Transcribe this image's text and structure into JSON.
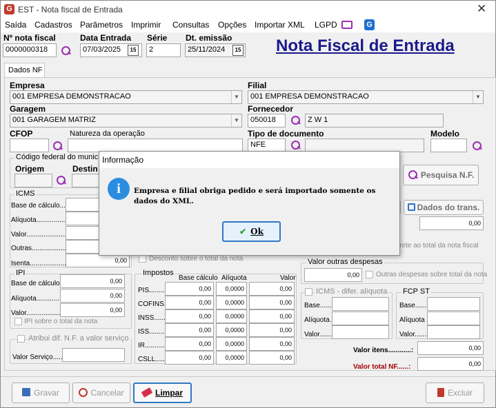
{
  "window": {
    "title": "EST - Nota fiscal de Entrada"
  },
  "menu": [
    "Saída",
    "Cadastros",
    "Parâmetros",
    "Imprimir",
    "Consultas",
    "Opções",
    "Importar XML",
    "LGPD"
  ],
  "header": {
    "nota_label": "Nº nota fiscal",
    "nota_value": "0000000318",
    "data_entrada_label": "Data Entrada",
    "data_entrada_value": "07/03/2025",
    "serie_label": "Série",
    "serie_value": "2",
    "dt_emissao_label": "Dt. emissão",
    "dt_emissao_value": "25/11/2024",
    "page_heading": "Nota Fiscal de Entrada"
  },
  "tab": {
    "label": "Dados NF"
  },
  "form": {
    "empresa_label": "Empresa",
    "empresa_value": "001 EMPRESA DEMONSTRACAO",
    "filial_label": "Filial",
    "filial_value": "001 EMPRESA DEMONSTRACAO",
    "garagem_label": "Garagem",
    "garagem_value": "001 GARAGEM MATRIZ",
    "fornecedor_label": "Fornecedor",
    "fornecedor_code": "050018",
    "fornecedor_name": "Z W 1",
    "cfop_label": "CFOP",
    "natureza_label": "Natureza da operação",
    "tipo_doc_label": "Tipo de documento",
    "tipo_doc_value": "NFE",
    "modelo_label": "Modelo",
    "codigo_municipio_label": "Código federal do munic",
    "origem_label": "Origem",
    "destino_label": "Destin",
    "pesquisa_button": "Pesquisa N.F.",
    "dados_trans_button": "Dados do trans."
  },
  "icms": {
    "title": "ICMS",
    "base_label": "Base de cálculo...:",
    "aliquota_label": "Alíquota.......................",
    "valor_label": "Valor................................",
    "outras_label": "Outras...........................",
    "isenta_label": "Isenta.............................",
    "isenta_value": "0,00"
  },
  "ipi": {
    "title": "IPI",
    "base_label": "Base de cálculo.:",
    "aliquota_label": "Alíquota....................",
    "valor_label": "Valor...........................",
    "values": [
      "0,00",
      "0,00",
      "0,00"
    ],
    "check_label": "IPI sobre o total da nota"
  },
  "atribui": {
    "label": "Atribui dif. N.F. a valor serviço",
    "valor_servico_label": "Valor Serviço...........",
    "valor_servico_value": ""
  },
  "desconto_label": "Desconto sobre o total da nota",
  "impostos": {
    "title": "Impostos",
    "col_headers": [
      "Base cálculo",
      "Alíquota",
      "Valor"
    ],
    "rows": [
      {
        "label": "PIS.........",
        "base": "0,00",
        "aliquota": "0,0000",
        "valor": "0,00"
      },
      {
        "label": "COFINS.",
        "base": "0,00",
        "aliquota": "0,0000",
        "valor": "0,00"
      },
      {
        "label": "INSS.......",
        "base": "0,00",
        "aliquota": "0,0000",
        "valor": "0,00"
      },
      {
        "label": "ISS..........",
        "base": "0,00",
        "aliquota": "0,0000",
        "valor": "0,00"
      },
      {
        "label": "IR..............",
        "base": "0,00",
        "aliquota": "0,0000",
        "valor": "0,00"
      },
      {
        "label": "CSLL........",
        "base": "0,00",
        "aliquota": "0,0000",
        "valor": "0,00"
      }
    ]
  },
  "right_panel": {
    "frete_value": "0,00",
    "frete_check_label": "ir frete ao total da nota fiscal",
    "outras_desp_title": "Valor outras despesas",
    "outras_desp_value": "0,00",
    "outras_desp_check": "Outras despesas sobre total da nota",
    "icms_dif_title": "ICMS - difer. alíquota",
    "icms_dif_base": "Base.........",
    "icms_dif_aliquota": "Alíquota....",
    "icms_dif_valor": "Valor.........",
    "fcp_title": "FCP ST",
    "fcp_base": "Base.........",
    "fcp_aliquota": "Alíquota",
    "fcp_valor": "Valor.........",
    "valor_itens_label": "Valor itens............:",
    "valor_itens_value": "0,00",
    "valor_total_label": "Valor total NF......:",
    "valor_total_value": "0,00"
  },
  "buttons": {
    "gravar": "Gravar",
    "cancelar": "Cancelar",
    "limpar": "Limpar",
    "excluir": "Excluir"
  },
  "dialog": {
    "title": "Informação",
    "message": "Empresa e filial obriga pedido e será importado somente os dados do XML.",
    "ok": "Ok"
  }
}
